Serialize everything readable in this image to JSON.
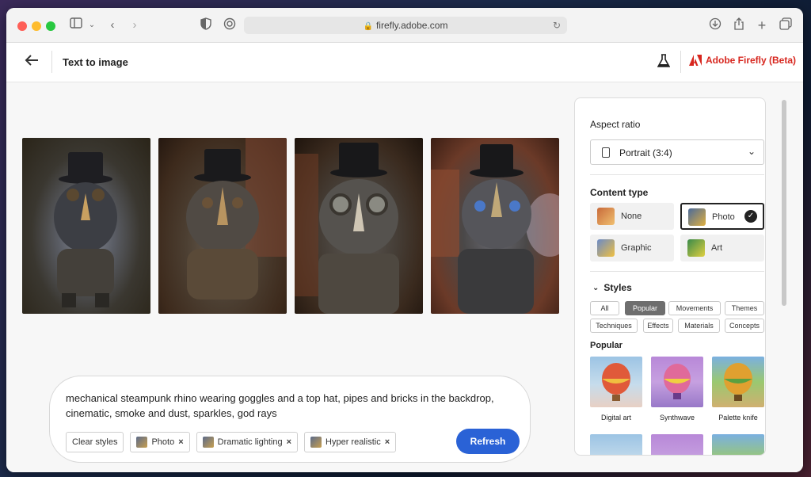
{
  "browser": {
    "url": "firefly.adobe.com"
  },
  "header": {
    "title": "Text to image",
    "brand": "Adobe Firefly (Beta)"
  },
  "prompt": {
    "text": "mechanical steampunk rhino wearing goggles and a top hat, pipes and bricks in the backdrop, cinematic, smoke and dust, sparkles, god rays",
    "clear_styles": "Clear styles",
    "chips": [
      "Photo",
      "Dramatic lighting",
      "Hyper realistic"
    ],
    "refresh": "Refresh"
  },
  "panel": {
    "aspect_ratio_label": "Aspect ratio",
    "aspect_ratio_value": "Portrait (3:4)",
    "content_type_label": "Content type",
    "content_types": [
      "None",
      "Photo",
      "Graphic",
      "Art"
    ],
    "content_type_selected": "Photo",
    "styles_label": "Styles",
    "style_tabs": [
      "All",
      "Popular",
      "Movements",
      "Themes",
      "Techniques",
      "Effects",
      "Materials",
      "Concepts"
    ],
    "style_tab_active": "Popular",
    "popular_label": "Popular",
    "popular_items": [
      "Digital art",
      "Synthwave",
      "Palette knife"
    ]
  },
  "colors": {
    "accent": "#2a62d6",
    "brand": "#d7261e"
  }
}
